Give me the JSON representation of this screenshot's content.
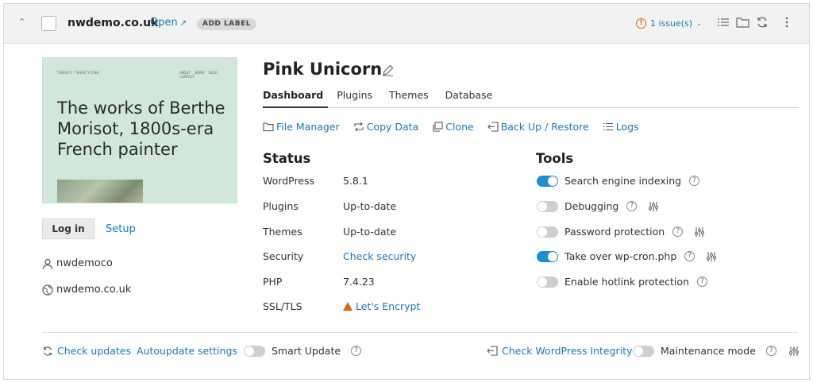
{
  "header": {
    "domain": "nwdemo.co.uk",
    "open_label": "Open",
    "add_label": "ADD LABEL",
    "issues_label": "1 issue(s)"
  },
  "thumbnail": {
    "site_name": "TWENTY TWENTY-ONE",
    "nav": "ABOUT WORK BLOG CONTACT",
    "headline": "The works of Berthe Morisot, 1800s-era French painter"
  },
  "sidebar": {
    "login_label": "Log in",
    "setup_label": "Setup",
    "username": "nwdemoco",
    "site_url": "nwdemo.co.uk"
  },
  "main": {
    "site_title": "Pink Unicorn",
    "tabs": [
      {
        "label": "Dashboard",
        "active": true
      },
      {
        "label": "Plugins",
        "active": false
      },
      {
        "label": "Themes",
        "active": false
      },
      {
        "label": "Database",
        "active": false
      }
    ],
    "quick_links": [
      {
        "label": "File Manager",
        "icon": "folder-icon"
      },
      {
        "label": "Copy Data",
        "icon": "copy-data-icon"
      },
      {
        "label": "Clone",
        "icon": "clone-icon"
      },
      {
        "label": "Back Up / Restore",
        "icon": "backup-icon"
      },
      {
        "label": "Logs",
        "icon": "logs-icon"
      }
    ]
  },
  "status": {
    "heading": "Status",
    "rows": [
      {
        "label": "WordPress",
        "value": "5.8.1"
      },
      {
        "label": "Plugins",
        "value": "Up-to-date"
      },
      {
        "label": "Themes",
        "value": "Up-to-date"
      },
      {
        "label": "Security",
        "value": "Check security"
      },
      {
        "label": "PHP",
        "value": "7.4.23"
      },
      {
        "label": "SSL/TLS",
        "value": "Let's Encrypt"
      }
    ]
  },
  "tools": {
    "heading": "Tools",
    "items": [
      {
        "label": "Search engine indexing",
        "on": true
      },
      {
        "label": "Debugging",
        "on": false
      },
      {
        "label": "Password protection",
        "on": false
      },
      {
        "label": "Take over wp-cron.php",
        "on": true
      },
      {
        "label": "Enable hotlink protection",
        "on": false
      }
    ]
  },
  "footer": {
    "check_updates": "Check updates",
    "autoupdate_settings": "Autoupdate settings",
    "smart_update": "Smart Update",
    "check_integrity": "Check WordPress Integrity",
    "maintenance_mode": "Maintenance mode"
  },
  "colors": {
    "link": "#1a7ab5",
    "toggle_on": "#1e8fd2",
    "warning": "#e0640f"
  }
}
